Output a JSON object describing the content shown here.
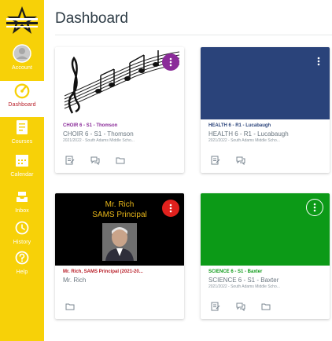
{
  "header": {
    "title": "Dashboard"
  },
  "nav": {
    "items": [
      {
        "label": "Account",
        "icon": "account-icon"
      },
      {
        "label": "Dashboard",
        "icon": "dashboard-icon",
        "active": true
      },
      {
        "label": "Courses",
        "icon": "courses-icon"
      },
      {
        "label": "Calendar",
        "icon": "calendar-icon"
      },
      {
        "label": "Inbox",
        "icon": "inbox-icon"
      },
      {
        "label": "History",
        "icon": "history-icon"
      },
      {
        "label": "Help",
        "icon": "help-icon"
      }
    ]
  },
  "cards": [
    {
      "name": "CHOIR 6 - S1 - Thomson",
      "code": "CHOIR 6 - S1 - Thomson",
      "term": "2021/2022 - South Adams Middle Scho...",
      "color": "#8a2b99",
      "actions": [
        "assignments-icon",
        "discussions-icon",
        "files-icon"
      ]
    },
    {
      "name": "HEALTH 6 - R1 - Lucabaugh",
      "code": "HEALTH 6 - R1 - Lucabaugh",
      "term": "2021/2022 - South Adams Middle Scho...",
      "color": "#2a437a",
      "actions": [
        "assignments-icon",
        "discussions-icon"
      ]
    },
    {
      "name": "Mr. Rich, SAMS Principal (2021-20...",
      "code": "Mr. Rich",
      "term": "",
      "color": "#b9202a",
      "hero_text": [
        "Mr. Rich",
        "SAMS Principal"
      ],
      "actions": [
        "files-icon"
      ]
    },
    {
      "name": "SCIENCE 6 - S1 - Baxter",
      "code": "SCIENCE 6 - S1 - Baxter",
      "term": "2021/2022 - South Adams Middle Scho...",
      "color": "#0c9a17",
      "actions": [
        "assignments-icon",
        "discussions-icon",
        "files-icon"
      ]
    }
  ],
  "colors": {
    "nav_bg": "#f7d108",
    "active_label": "#b9202a",
    "title_text": "#2d3b45"
  }
}
